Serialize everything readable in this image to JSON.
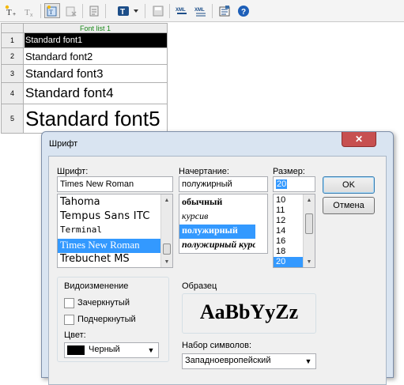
{
  "toolbar": {
    "icons": [
      "add-font-icon",
      "clear-format-icon",
      "new-list-icon",
      "delete-list-icon",
      "paste-format-icon",
      "text-style-icon",
      "save-icon",
      "export-xml-icon",
      "import-xml-icon",
      "properties-icon",
      "help-icon"
    ]
  },
  "grid": {
    "column_header": "Font list 1",
    "rows": [
      {
        "num": "1",
        "text": "Standard font1"
      },
      {
        "num": "2",
        "text": "Standard font2"
      },
      {
        "num": "3",
        "text": "Standard font3"
      },
      {
        "num": "4",
        "text": "Standard font4"
      },
      {
        "num": "5",
        "text": "Standard font5"
      }
    ]
  },
  "dialog": {
    "title": "Шрифт",
    "close_glyph": "✕",
    "font": {
      "label": "Шрифт:",
      "value": "Times New Roman",
      "items": [
        "Tahoma",
        "Tempus Sans ITC",
        "Terminal",
        "Times New Roman",
        "Trebuchet MS"
      ],
      "selected_index": 3
    },
    "style": {
      "label": "Начертание:",
      "value": "полужирный",
      "items": [
        "обычный",
        "курсив",
        "полужирный",
        "полужирный курсив"
      ],
      "selected_index": 2
    },
    "size": {
      "label": "Размер:",
      "value": "20",
      "items": [
        "10",
        "11",
        "12",
        "14",
        "16",
        "18",
        "20"
      ],
      "selected_index": 6
    },
    "ok_label": "OK",
    "cancel_label": "Отмена",
    "effects": {
      "label": "Видоизменение",
      "strike_label": "Зачеркнутый",
      "underline_label": "Подчеркнутый",
      "strike_checked": false,
      "underline_checked": false,
      "color_label": "Цвет:",
      "color_value": "Черный",
      "color_swatch": "#000000"
    },
    "sample": {
      "label": "Образец",
      "text": "AaBbYyZz"
    },
    "charset": {
      "label": "Набор символов:",
      "value": "Западноевропейский"
    }
  },
  "colors": {
    "accent": "#3399ff",
    "grid_header_text": "#1a8a1a",
    "selected_cell": "#000000",
    "close_button": "#c75050"
  }
}
